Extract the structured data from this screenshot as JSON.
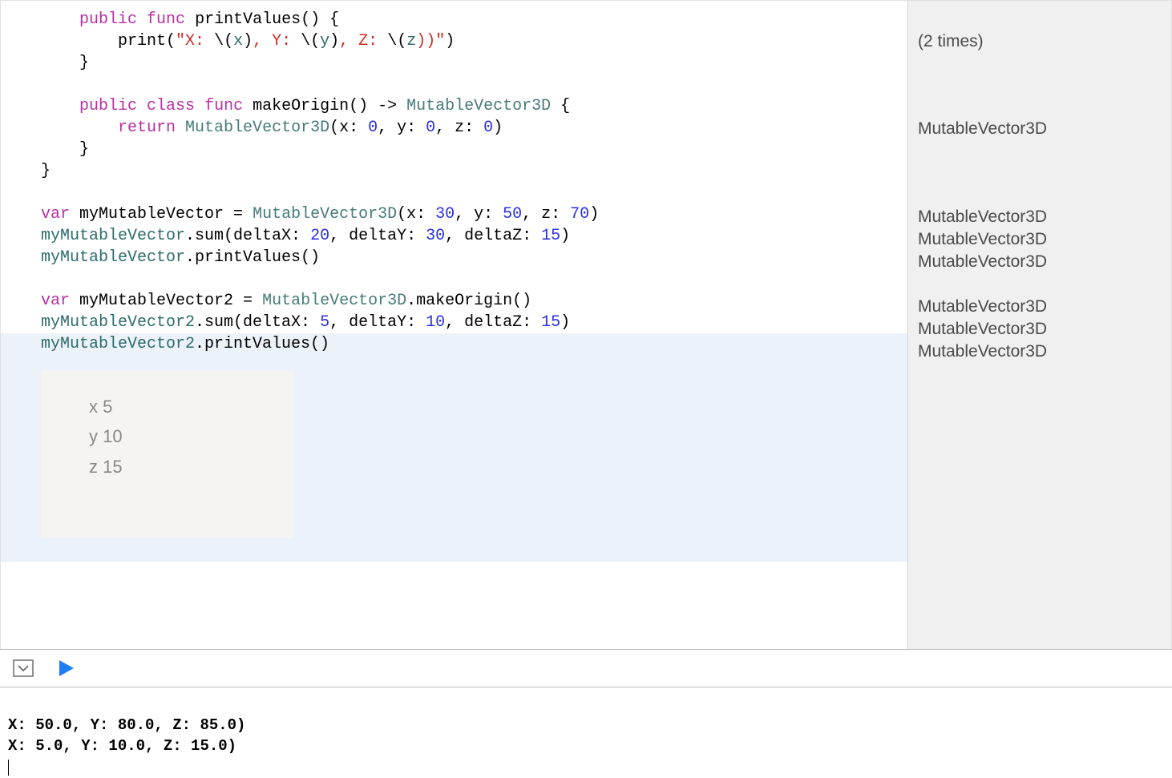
{
  "code": {
    "line1_kw1": "public",
    "line1_kw2": "func",
    "line1_name": " printValues() {",
    "line2_print": "print",
    "line2_str1": "\"X: ",
    "line2_esc1": "\\(",
    "line2_id1": "x",
    "line2_esc2": ")",
    "line2_str2": ", Y: ",
    "line2_esc3": "\\(",
    "line2_id2": "y",
    "line2_esc4": ")",
    "line2_str3": ", Z: ",
    "line2_esc5": "\\(",
    "line2_id3": "z",
    "line2_esc6": "))\"",
    "line2_close": ")",
    "line3": "    }",
    "line5_kw1": "public",
    "line5_kw2": "class",
    "line5_kw3": "func",
    "line5_name": " makeOrigin() -> ",
    "line5_type": "MutableVector3D",
    "line5_brace": " {",
    "line6_kw": "return",
    "line6_type": "MutableVector3D",
    "line6_sig1": "(x: ",
    "line6_n1": "0",
    "line6_sig2": ", y: ",
    "line6_n2": "0",
    "line6_sig3": ", z: ",
    "line6_n3": "0",
    "line6_close": ")",
    "line7": "    }",
    "line8": "}",
    "line10_kw": "var",
    "line10_name": " myMutableVector = ",
    "line10_type": "MutableVector3D",
    "line10_sig1": "(x: ",
    "line10_n1": "30",
    "line10_sig2": ", y: ",
    "line10_n2": "50",
    "line10_sig3": ", z: ",
    "line10_n3": "70",
    "line10_close": ")",
    "line11_obj": "myMutableVector",
    "line11_call": ".sum(deltaX: ",
    "line11_n1": "20",
    "line11_sig2": ", deltaY: ",
    "line11_n2": "30",
    "line11_sig3": ", deltaZ: ",
    "line11_n3": "15",
    "line11_close": ")",
    "line12_obj": "myMutableVector",
    "line12_call": ".printValues()",
    "line14_kw": "var",
    "line14_name": " myMutableVector2 = ",
    "line14_type": "MutableVector3D",
    "line14_call": ".makeOrigin()",
    "line15_obj": "myMutableVector2",
    "line15_call": ".sum(deltaX: ",
    "line15_n1": "5",
    "line15_sig2": ", deltaY: ",
    "line15_n2": "10",
    "line15_sig3": ", deltaZ: ",
    "line15_n3": "15",
    "line15_close": ")",
    "line16_obj": "myMutableVector2",
    "line16_call": ".printValues()"
  },
  "inline_panel": {
    "l1": "x 5",
    "l2": "y 10",
    "l3": "z 15"
  },
  "results": {
    "r_spacer_top": "",
    "r1": "(2 times)",
    "r2": "MutableVector3D",
    "r3": "MutableVector3D",
    "r4": "MutableVector3D",
    "r5": "MutableVector3D",
    "r6": "MutableVector3D",
    "r7": "MutableVector3D",
    "r8": "MutableVector3D"
  },
  "console": {
    "l1": "X: 50.0, Y: 80.0, Z: 85.0)",
    "l2": "X: 5.0, Y: 10.0, Z: 15.0)"
  }
}
